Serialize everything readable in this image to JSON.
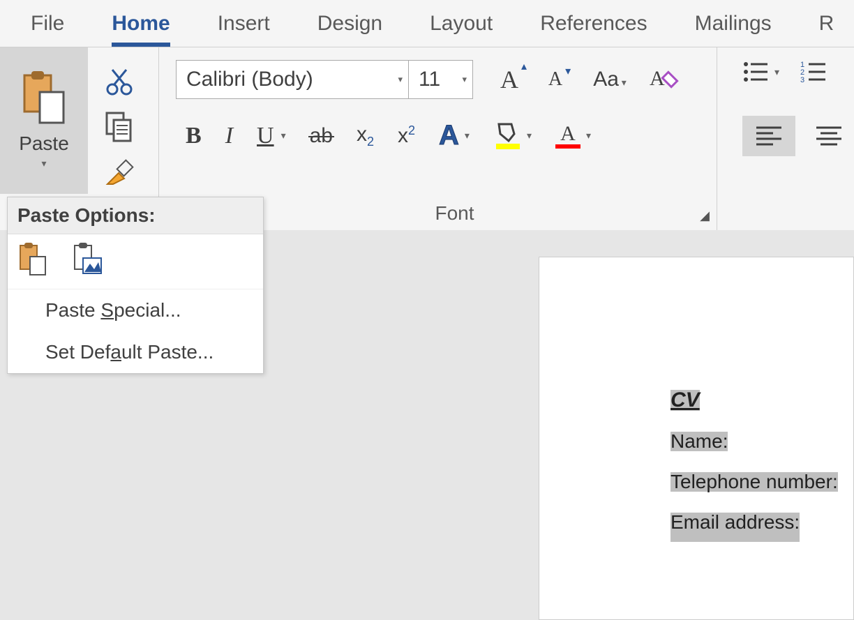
{
  "tabs": {
    "file": "File",
    "home": "Home",
    "insert": "Insert",
    "design": "Design",
    "layout": "Layout",
    "references": "References",
    "mailings": "Mailings",
    "partial": "R"
  },
  "clipboard": {
    "paste_label": "Paste"
  },
  "font": {
    "name": "Calibri (Body)",
    "size": "11",
    "group_label": "Font",
    "bold": "B",
    "italic": "I",
    "underline": "U",
    "strike": "ab",
    "sub_x": "x",
    "sub_2": "2",
    "sup_x": "x",
    "sup_2": "2",
    "case": "Aa",
    "textfx_A": "A",
    "grow_A": "A",
    "shrink_A": "A",
    "fontcolor_A": "A",
    "highlight_A": "A"
  },
  "paste_menu": {
    "header": "Paste Options:",
    "special_pre": "Paste ",
    "special_u": "S",
    "special_post": "pecial...",
    "default_pre": "Set Def",
    "default_u": "a",
    "default_post": "ult Paste..."
  },
  "document": {
    "title": "CV",
    "name": "Name:",
    "tel": "Telephone number:",
    "email": "Email address:"
  }
}
